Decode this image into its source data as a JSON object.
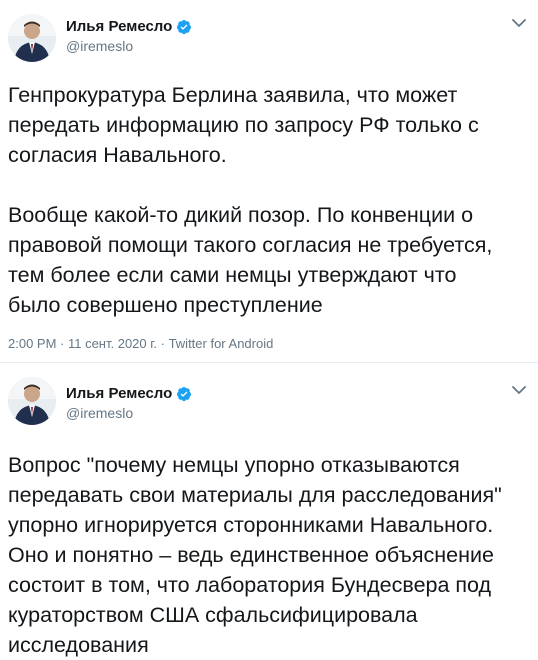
{
  "tweets": [
    {
      "author_name": "Илья Ремесло",
      "handle": "@iremeslo",
      "text": "Генпрокуратура Берлина заявила, что может\nпередать информацию по запросу РФ только с\nсогласия Навального.\n\nВообще какой-то дикий позор. По конвенции о\nправовой помощи такого согласия не требуется,\nтем более если сами немцы утверждают что\nбыло совершено преступление",
      "meta": "2:00 PM · 11 сент. 2020 г. · Twitter for Android"
    },
    {
      "author_name": "Илья Ремесло",
      "handle": "@iremeslo",
      "text": "Вопрос \"почему немцы упорно отказываются\nпередавать свои материалы для расследования\"\nупорно игнорируется сторонниками Навального.\nОно и понятно – ведь единственное объяснение\nсостоит в том, что лаборатория Бундесвера под\nкураторством США сфальсифицировала\nисследования"
    }
  ],
  "colors": {
    "verified": "#1da1f2",
    "secondary_text": "#657786",
    "primary_text": "#14171a"
  },
  "icons": {
    "verified": "verified-badge-icon",
    "menu": "chevron-down-icon"
  }
}
